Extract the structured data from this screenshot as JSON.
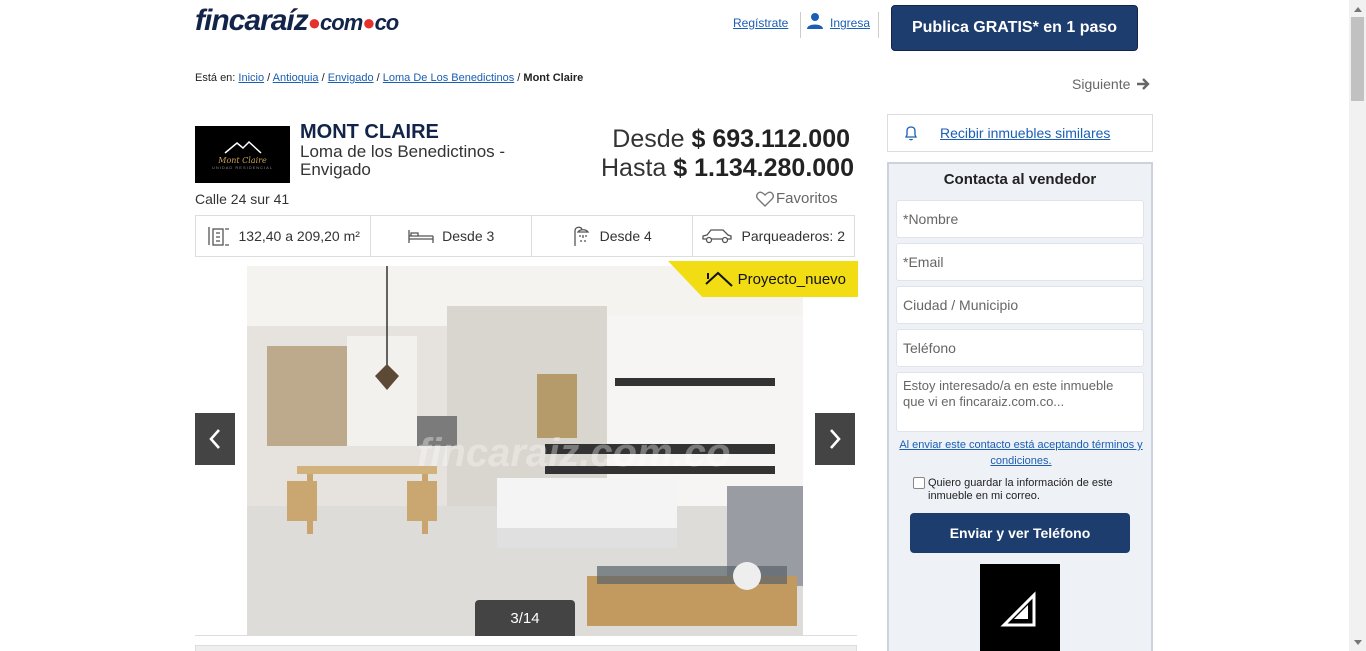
{
  "header": {
    "logo_main": "fincaraíz",
    "logo_com": "com",
    "logo_co": "co",
    "register_label": "Regístrate",
    "login_label": "Ingresa",
    "publish_label": "Publica GRATIS* en 1 paso"
  },
  "breadcrumb": {
    "prefix": "Está en:",
    "items": [
      "Inicio",
      "Antioquia",
      "Envigado",
      "Loma De Los Benedictinos"
    ],
    "current": "Mont Claire",
    "next_label": "Siguiente"
  },
  "project": {
    "logo_name": "Mont Claire",
    "logo_sub": "UNIDAD RESIDENCIAL",
    "title": "MONT CLAIRE",
    "location": "Loma de los Benedictinos - Envigado",
    "price_from_label": "Desde",
    "price_from": "$ 693.112.000",
    "price_to_label": "Hasta",
    "price_to": "$ 1.134.280.000",
    "address": "Calle 24 sur 41",
    "favorites_label": "Favoritos"
  },
  "features": [
    {
      "icon": "area-icon",
      "label": "132,40 a 209,20 m²"
    },
    {
      "icon": "bed-icon",
      "label": "Desde  3"
    },
    {
      "icon": "shower-icon",
      "label": "Desde  4"
    },
    {
      "icon": "car-icon",
      "label": "Parqueaderos: 2"
    }
  ],
  "gallery": {
    "badge": "Proyecto_nuevo",
    "counter": "3/14",
    "watermark": "fincaraiz.com.co"
  },
  "sidebar": {
    "similar_label": "Recibir inmuebles similares",
    "contact_title": "Contacta al vendedor",
    "name_placeholder": "*Nombre",
    "email_placeholder": "*Email",
    "city_placeholder": "Ciudad / Municipio",
    "phone_placeholder": "Teléfono",
    "message_placeholder": "Estoy interesado/a en este inmueble que vi en fincaraiz.com.co...",
    "terms_text": "Al enviar este contacto está aceptando términos y condiciones.",
    "save_text": "Quiero guardar la información de este inmueble en mi correo.",
    "send_label": "Enviar y ver Teléfono"
  },
  "colors": {
    "brand_navy": "#1d3d6e",
    "brand_red": "#e4312b",
    "link_blue": "#1a5fb4",
    "badge_yellow": "#f2dd15"
  }
}
